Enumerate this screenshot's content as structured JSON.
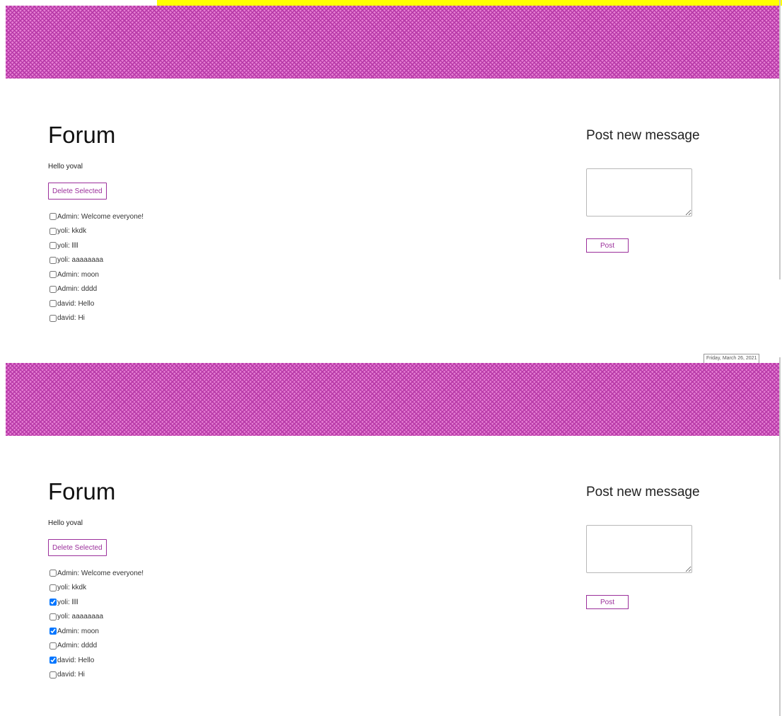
{
  "colors": {
    "accent": "#9b2f9b",
    "banner": "#e57fd3",
    "highlight": "#ffff00"
  },
  "footer": {
    "date": "Friday, March 26, 2021"
  },
  "panels": [
    {
      "title": "Forum",
      "greeting": "Hello yoval",
      "delete_label": "Delete Selected",
      "post_heading": "Post new message",
      "post_label": "Post",
      "messages": [
        {
          "text": "Admin: Welcome everyone!",
          "checked": false
        },
        {
          "text": "yoli: kkdk",
          "checked": false
        },
        {
          "text": "yoli: llll",
          "checked": false
        },
        {
          "text": "yoli: aaaaaaaa",
          "checked": false
        },
        {
          "text": "Admin: moon",
          "checked": false
        },
        {
          "text": "Admin: dddd",
          "checked": false
        },
        {
          "text": "david: Hello",
          "checked": false
        },
        {
          "text": "david: Hi",
          "checked": false
        }
      ]
    },
    {
      "title": "Forum",
      "greeting": "Hello yoval",
      "delete_label": "Delete Selected",
      "post_heading": "Post new message",
      "post_label": "Post",
      "messages": [
        {
          "text": "Admin: Welcome everyone!",
          "checked": false
        },
        {
          "text": "yoli: kkdk",
          "checked": false
        },
        {
          "text": "yoli: llll",
          "checked": true
        },
        {
          "text": "yoli: aaaaaaaa",
          "checked": false
        },
        {
          "text": "Admin: moon",
          "checked": true
        },
        {
          "text": "Admin: dddd",
          "checked": false
        },
        {
          "text": "david: Hello",
          "checked": true
        },
        {
          "text": "david: Hi",
          "checked": false
        }
      ]
    }
  ]
}
